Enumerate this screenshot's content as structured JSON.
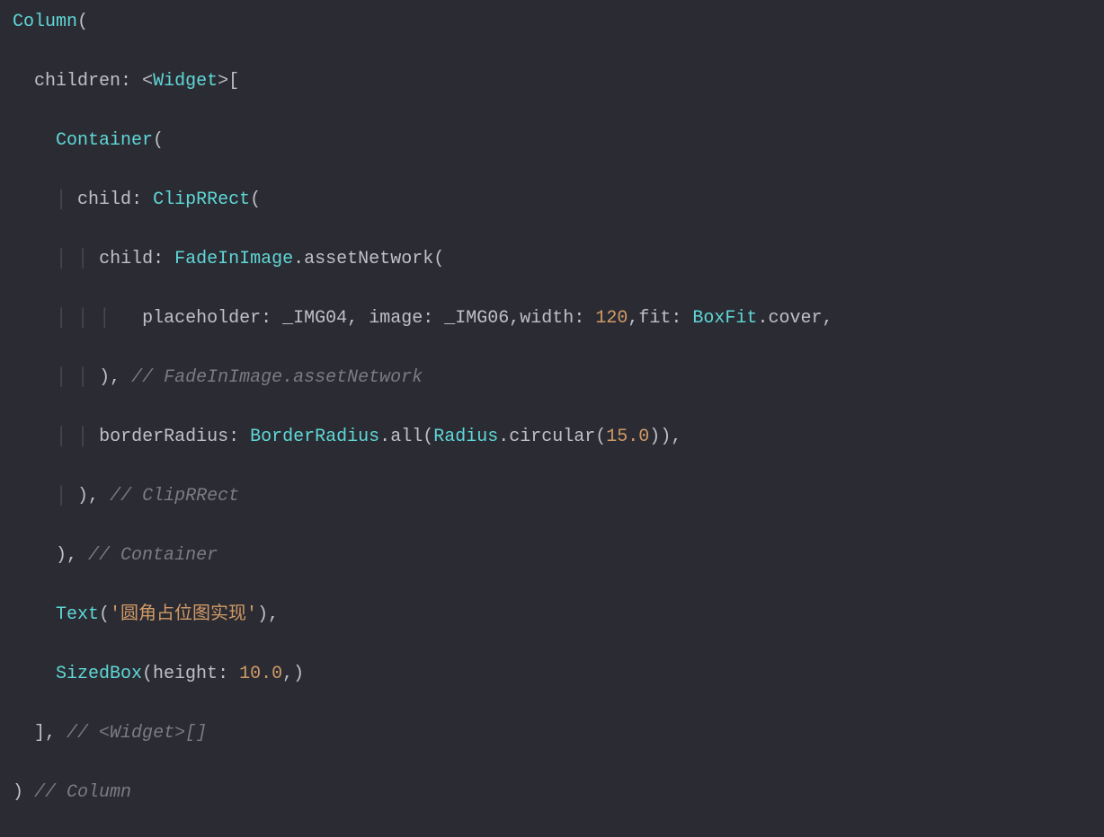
{
  "code": {
    "l1": {
      "Column": "Column",
      "open": "("
    },
    "l2": {
      "children": "children",
      "colon": ":",
      "lt": "<",
      "Widget": "Widget",
      "gt": ">",
      "br": "["
    },
    "l3": {
      "Container": "Container",
      "open": "("
    },
    "l4": {
      "child": "child",
      "colon": ":",
      "ClipRRect": "ClipRRect",
      "open": "("
    },
    "l5": {
      "child": "child",
      "colon": ":",
      "FadeInImage": "FadeInImage",
      "dot": ".",
      "assetNetwork": "assetNetwork",
      "open": "("
    },
    "l6": {
      "placeholder": "placeholder",
      "c1": ":",
      "v1": "_IMG04",
      "cm1": ",",
      "image": "image",
      "c2": ":",
      "v2": "_IMG06",
      "cm2": ",",
      "width": "width",
      "c3": ":",
      "n1": "120",
      "cm3": ",",
      "fit": "fit",
      "c4": ":",
      "BoxFit": "BoxFit",
      "dot": ".",
      "cover": "cover",
      "cm4": ","
    },
    "l7": {
      "close": "),",
      "comment": "// FadeInImage.assetNetwork"
    },
    "l8": {
      "borderRadius": "borderRadius",
      "colon": ":",
      "BorderRadius": "BorderRadius",
      "dot1": ".",
      "all": "all",
      "op1": "(",
      "Radius": "Radius",
      "dot2": ".",
      "circular": "circular",
      "op2": "(",
      "n": "15.0",
      "cl2": ")",
      "cl1": ")",
      "cm": ","
    },
    "l9": {
      "close": "),",
      "comment": "// ClipRRect"
    },
    "l10": {
      "close": "),",
      "comment": "// Container"
    },
    "l11": {
      "Text": "Text",
      "open": "(",
      "str": "'圆角占位图实现'",
      "close": ")",
      "cm": ","
    },
    "l12": {
      "SizedBox": "SizedBox",
      "open": "(",
      "height": "height",
      "colon": ":",
      "n": "10.0",
      "cm1": ",",
      "close": ")"
    },
    "l13": {
      "close": "],",
      "comment": "// <Widget>[]"
    },
    "l14": {
      "close": ")",
      "comment": "// Column"
    }
  }
}
